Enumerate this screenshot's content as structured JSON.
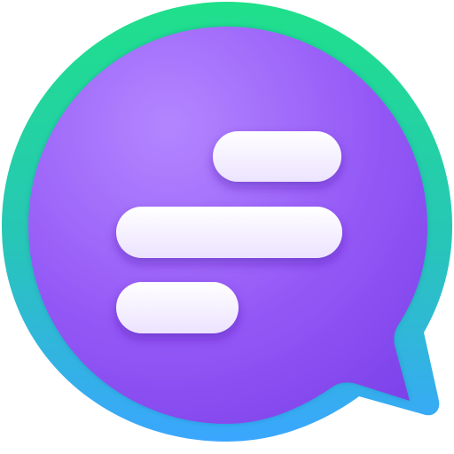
{
  "app_icon": {
    "icon_name": "chat-bubble-icon",
    "colors": {
      "ring_top": "#1fe08a",
      "ring_bottom": "#3aa6ff",
      "bubble_top": "#b07cff",
      "bubble_bottom": "#7a3fe8",
      "lines": "#f7f1ff",
      "line_shadow": "#5a2bbd"
    }
  }
}
